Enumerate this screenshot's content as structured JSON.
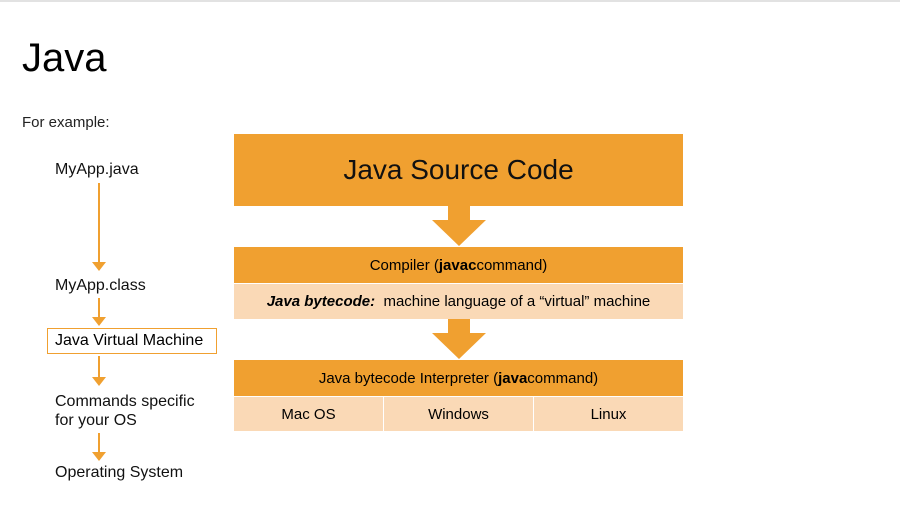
{
  "title": "Java",
  "subtitle": "For example:",
  "left_flow": {
    "steps": [
      "MyApp.java",
      "MyApp.class",
      "Java Virtual Machine",
      "Commands specific",
      "for your OS",
      "Operating System"
    ]
  },
  "diagram": {
    "source_label": "Java Source Code",
    "compiler": {
      "prefix": "Compiler (",
      "keyword": "javac",
      "suffix": " command)"
    },
    "bytecode": {
      "label": "Java bytecode:",
      "text": "machine language of a “virtual” machine"
    },
    "interpreter": {
      "prefix": "Java bytecode Interpreter (",
      "keyword": "java",
      "suffix": " command)"
    },
    "platforms": [
      "Mac OS",
      "Windows",
      "Linux"
    ]
  },
  "colors": {
    "accent": "#f0a030",
    "light": "#fad9b6"
  }
}
